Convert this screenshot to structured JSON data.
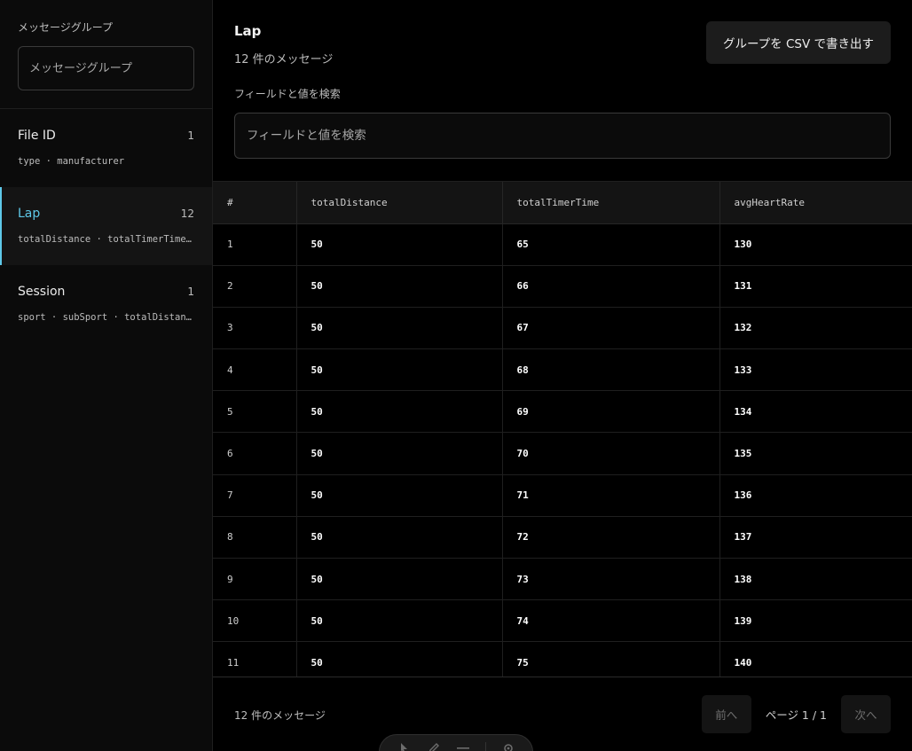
{
  "sidebar": {
    "filter_label": "メッセージグループ",
    "filter_placeholder": "メッセージグループ",
    "groups": [
      {
        "name": "File ID",
        "count": "1",
        "fields": "type · manufacturer",
        "active": false
      },
      {
        "name": "Lap",
        "count": "12",
        "fields": "totalDistance · totalTimerTime · avgHeartRate",
        "active": true
      },
      {
        "name": "Session",
        "count": "1",
        "fields": "sport · subSport · totalDistance · totalTimerTime",
        "active": false
      }
    ]
  },
  "main": {
    "title": "Lap",
    "subtitle": "12 件のメッセージ",
    "export_label": "グループを CSV で書き出す",
    "search_label": "フィールドと値を検索",
    "search_placeholder": "フィールドと値を検索"
  },
  "table": {
    "columns": [
      "#",
      "totalDistance",
      "totalTimerTime",
      "avgHeartRate"
    ],
    "rows": [
      [
        "1",
        "50",
        "65",
        "130"
      ],
      [
        "2",
        "50",
        "66",
        "131"
      ],
      [
        "3",
        "50",
        "67",
        "132"
      ],
      [
        "4",
        "50",
        "68",
        "133"
      ],
      [
        "5",
        "50",
        "69",
        "134"
      ],
      [
        "6",
        "50",
        "70",
        "135"
      ],
      [
        "7",
        "50",
        "71",
        "136"
      ],
      [
        "8",
        "50",
        "72",
        "137"
      ],
      [
        "9",
        "50",
        "73",
        "138"
      ],
      [
        "10",
        "50",
        "74",
        "139"
      ],
      [
        "11",
        "50",
        "75",
        "140"
      ]
    ]
  },
  "footer": {
    "count": "12 件のメッセージ",
    "prev_label": "前へ",
    "page_info": "ページ 1 / 1",
    "next_label": "次へ"
  },
  "toolbar": {
    "icons": [
      "pointer-icon",
      "pen-icon",
      "menu-icon",
      "gear-icon"
    ]
  },
  "colors": {
    "accent": "#5ec8e8",
    "background": "#000000",
    "sidebar_bg": "#0b0b0b"
  }
}
